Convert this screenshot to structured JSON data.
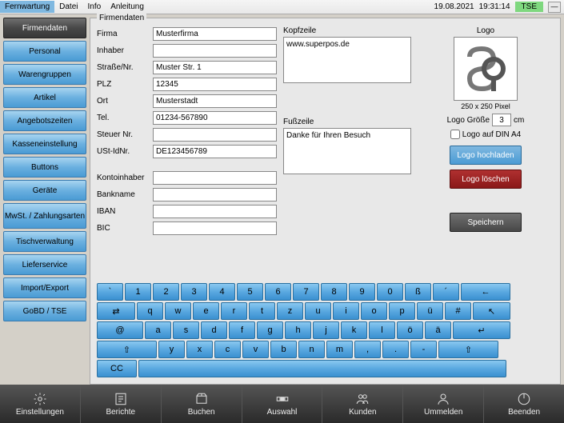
{
  "menubar": {
    "items": [
      "Fernwartung",
      "Datei",
      "Info",
      "Anleitung"
    ],
    "date": "19.08.2021",
    "time": "19:31:14",
    "tse": "TSE"
  },
  "sidebar": {
    "items": [
      {
        "label": "Firmendaten",
        "active": true
      },
      {
        "label": "Personal"
      },
      {
        "label": "Warengruppen"
      },
      {
        "label": "Artikel"
      },
      {
        "label": "Angebotszeiten"
      },
      {
        "label": "Kasseneinstellung"
      },
      {
        "label": "Buttons"
      },
      {
        "label": "Geräte"
      },
      {
        "label": "MwSt. / Zahlungsarten",
        "tall": true
      },
      {
        "label": "Tischverwaltung"
      },
      {
        "label": "Lieferservice"
      },
      {
        "label": "Import/Export"
      },
      {
        "label": "GoBD / TSE"
      }
    ]
  },
  "fieldset_title": "Firmendaten",
  "fields": {
    "firma": {
      "label": "Firma",
      "value": "Musterfirma"
    },
    "inhaber": {
      "label": "Inhaber",
      "value": ""
    },
    "strasse": {
      "label": "Straße/Nr.",
      "value": "Muster Str. 1"
    },
    "plz": {
      "label": "PLZ",
      "value": "12345"
    },
    "ort": {
      "label": "Ort",
      "value": "Musterstadt"
    },
    "tel": {
      "label": "Tel.",
      "value": "01234-567890"
    },
    "steuernr": {
      "label": "Steuer Nr.",
      "value": ""
    },
    "ustid": {
      "label": "USt-IdNr.",
      "value": "DE123456789"
    },
    "kontoinhaber": {
      "label": "Kontoinhaber",
      "value": ""
    },
    "bankname": {
      "label": "Bankname",
      "value": ""
    },
    "iban": {
      "label": "IBAN",
      "value": ""
    },
    "bic": {
      "label": "BIC",
      "value": ""
    }
  },
  "kopfzeile": {
    "label": "Kopfzeile",
    "value": "www.superpos.de"
  },
  "fusszeile": {
    "label": "Fußzeile",
    "value": "Danke für Ihren Besuch"
  },
  "logo": {
    "title": "Logo",
    "caption": "250 x 250 Pixel",
    "size_label": "Logo Größe",
    "size_value": "3",
    "size_unit": "cm",
    "dinA4": "Logo auf DIN A4",
    "upload": "Logo hochladen",
    "delete": "Logo löschen",
    "save": "Speichern"
  },
  "keyboard": {
    "row1": [
      "`",
      "1",
      "2",
      "3",
      "4",
      "5",
      "6",
      "7",
      "8",
      "9",
      "0",
      "ß",
      "´",
      "←"
    ],
    "row2": [
      "⇄",
      "q",
      "w",
      "e",
      "r",
      "t",
      "z",
      "u",
      "i",
      "o",
      "p",
      "ü",
      "#",
      "↖"
    ],
    "row3": [
      "@",
      "a",
      "s",
      "d",
      "f",
      "g",
      "h",
      "j",
      "k",
      "l",
      "ö",
      "ä",
      "↵"
    ],
    "row4": [
      "⇧",
      "y",
      "x",
      "c",
      "v",
      "b",
      "n",
      "m",
      ",",
      ".",
      "-",
      "⇧"
    ],
    "row5": [
      "CC",
      " "
    ]
  },
  "bottombar": {
    "items": [
      "Einstellungen",
      "Berichte",
      "Buchen",
      "Auswahl",
      "Kunden",
      "Ummelden",
      "Beenden"
    ]
  }
}
